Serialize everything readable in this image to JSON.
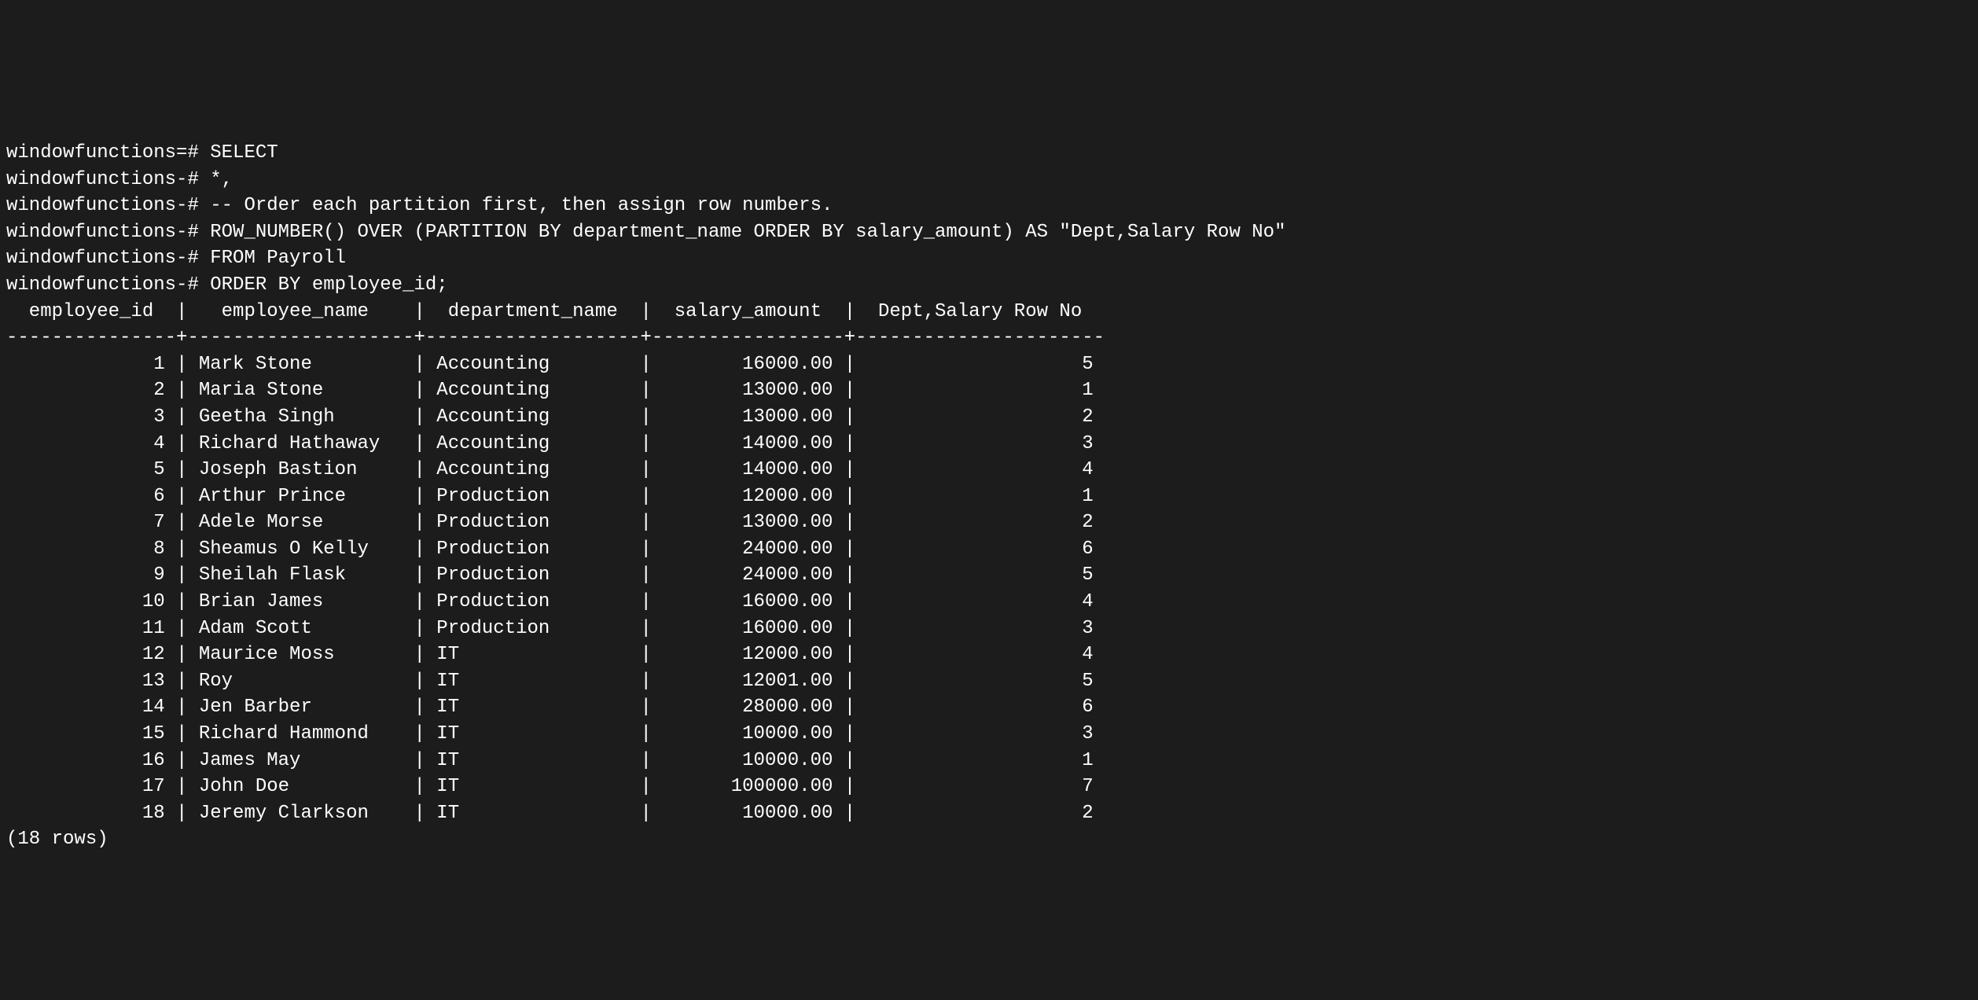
{
  "prompt_db": "windowfunctions",
  "query_lines": [
    {
      "prompt_suffix": "=#",
      "text": "SELECT"
    },
    {
      "prompt_suffix": "-#",
      "text": "*,"
    },
    {
      "prompt_suffix": "-#",
      "text": "-- Order each partition first, then assign row numbers."
    },
    {
      "prompt_suffix": "-#",
      "text": "ROW_NUMBER() OVER (PARTITION BY department_name ORDER BY salary_amount) AS \"Dept,Salary Row No\""
    },
    {
      "prompt_suffix": "-#",
      "text": "FROM Payroll"
    },
    {
      "prompt_suffix": "-#",
      "text": "ORDER BY employee_id;"
    }
  ],
  "columns": [
    {
      "name": "employee_id",
      "width": 13,
      "align": "right"
    },
    {
      "name": "employee_name",
      "width": 18,
      "align": "left"
    },
    {
      "name": "department_name",
      "width": 17,
      "align": "left"
    },
    {
      "name": "salary_amount",
      "width": 15,
      "align": "right"
    },
    {
      "name": "Dept,Salary Row No",
      "width": 20,
      "align": "right"
    }
  ],
  "rows": [
    {
      "employee_id": "1",
      "employee_name": "Mark Stone",
      "department_name": "Accounting",
      "salary_amount": "16000.00",
      "row_no": "5"
    },
    {
      "employee_id": "2",
      "employee_name": "Maria Stone",
      "department_name": "Accounting",
      "salary_amount": "13000.00",
      "row_no": "1"
    },
    {
      "employee_id": "3",
      "employee_name": "Geetha Singh",
      "department_name": "Accounting",
      "salary_amount": "13000.00",
      "row_no": "2"
    },
    {
      "employee_id": "4",
      "employee_name": "Richard Hathaway",
      "department_name": "Accounting",
      "salary_amount": "14000.00",
      "row_no": "3"
    },
    {
      "employee_id": "5",
      "employee_name": "Joseph Bastion",
      "department_name": "Accounting",
      "salary_amount": "14000.00",
      "row_no": "4"
    },
    {
      "employee_id": "6",
      "employee_name": "Arthur Prince",
      "department_name": "Production",
      "salary_amount": "12000.00",
      "row_no": "1"
    },
    {
      "employee_id": "7",
      "employee_name": "Adele Morse",
      "department_name": "Production",
      "salary_amount": "13000.00",
      "row_no": "2"
    },
    {
      "employee_id": "8",
      "employee_name": "Sheamus O Kelly",
      "department_name": "Production",
      "salary_amount": "24000.00",
      "row_no": "6"
    },
    {
      "employee_id": "9",
      "employee_name": "Sheilah Flask",
      "department_name": "Production",
      "salary_amount": "24000.00",
      "row_no": "5"
    },
    {
      "employee_id": "10",
      "employee_name": "Brian James",
      "department_name": "Production",
      "salary_amount": "16000.00",
      "row_no": "4"
    },
    {
      "employee_id": "11",
      "employee_name": "Adam Scott",
      "department_name": "Production",
      "salary_amount": "16000.00",
      "row_no": "3"
    },
    {
      "employee_id": "12",
      "employee_name": "Maurice Moss",
      "department_name": "IT",
      "salary_amount": "12000.00",
      "row_no": "4"
    },
    {
      "employee_id": "13",
      "employee_name": "Roy",
      "department_name": "IT",
      "salary_amount": "12001.00",
      "row_no": "5"
    },
    {
      "employee_id": "14",
      "employee_name": "Jen Barber",
      "department_name": "IT",
      "salary_amount": "28000.00",
      "row_no": "6"
    },
    {
      "employee_id": "15",
      "employee_name": "Richard Hammond",
      "department_name": "IT",
      "salary_amount": "10000.00",
      "row_no": "3"
    },
    {
      "employee_id": "16",
      "employee_name": "James May",
      "department_name": "IT",
      "salary_amount": "10000.00",
      "row_no": "1"
    },
    {
      "employee_id": "17",
      "employee_name": "John Doe",
      "department_name": "IT",
      "salary_amount": "100000.00",
      "row_no": "7"
    },
    {
      "employee_id": "18",
      "employee_name": "Jeremy Clarkson",
      "department_name": "IT",
      "salary_amount": "10000.00",
      "row_no": "2"
    }
  ],
  "row_count_text": "(18 rows)"
}
